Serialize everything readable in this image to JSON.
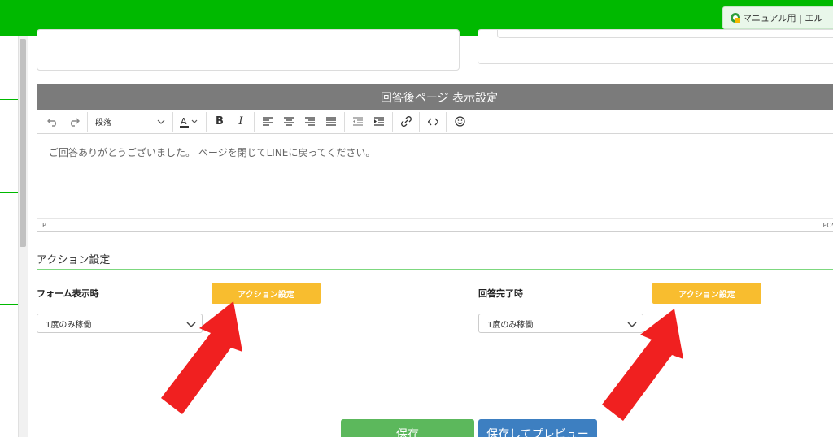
{
  "header": {
    "manual_button_label": "マニュアル用 | エル"
  },
  "editor": {
    "title": "回答後ページ 表示設定",
    "toolbar": {
      "paragraph_select": "段落"
    },
    "content": "ご回答ありがとうございました。 ページを閉じてLINEに戻ってください。",
    "status_path": "P",
    "status_right": "POV"
  },
  "actions": {
    "heading": "アクション設定",
    "form_display": {
      "label": "フォーム表示時",
      "button": "アクション設定",
      "select_value": "1度のみ稼働"
    },
    "answer_complete": {
      "label": "回答完了時",
      "button": "アクション設定",
      "select_value": "1度のみ稼働"
    }
  },
  "footer": {
    "save_label": "保存",
    "save_preview_label": "保存してプレビュー"
  },
  "colors": {
    "brand": "#00b900",
    "action_button": "#f8bd2f",
    "save_button": "#5cb85c",
    "preview_button": "#3d7fc1",
    "annotation_arrow": "#f02020"
  },
  "icons": [
    "undo-icon",
    "redo-icon",
    "font-color-icon",
    "bold-icon",
    "italic-icon",
    "align-left-icon",
    "align-center-icon",
    "align-right-icon",
    "align-justify-icon",
    "outdent-icon",
    "indent-icon",
    "link-icon",
    "code-icon",
    "emoji-icon",
    "chevron-down-icon"
  ]
}
